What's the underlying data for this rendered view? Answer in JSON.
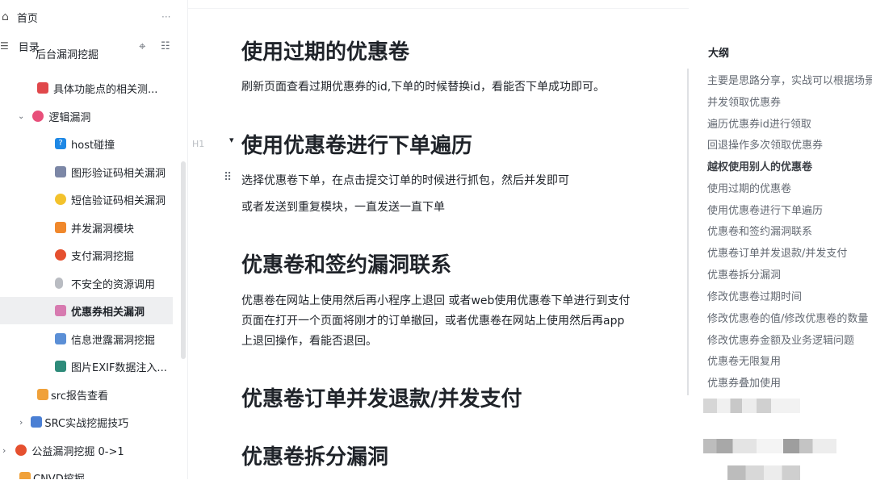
{
  "sidebar": {
    "home_label": "首页",
    "more_glyph": "···",
    "toc_label": "目录",
    "items": [
      {
        "label": "后台漏洞挖掘",
        "emoji": "",
        "color": "#ffffff"
      },
      {
        "label": "具体功能点的相关测...",
        "emoji": "ogre",
        "color": "#e0484b"
      },
      {
        "label": "逻辑漏洞",
        "emoji": "heart",
        "color": "#e84f7a",
        "expanded": true
      },
      {
        "label": "host碰撞",
        "emoji": "question",
        "color": "#1e88e5"
      },
      {
        "label": "图形验证码相关漏洞",
        "emoji": "robot",
        "color": "#7c87a6"
      },
      {
        "label": "短信验证码相关漏洞",
        "emoji": "sparkles",
        "color": "#f3c22c"
      },
      {
        "label": "并发漏洞模块",
        "emoji": "no-entry",
        "color": "#f0882c"
      },
      {
        "label": "支付漏洞挖掘",
        "emoji": "collision",
        "color": "#e5502f"
      },
      {
        "label": "不安全的资源调用",
        "emoji": "mouse",
        "color": "#b9bcc2"
      },
      {
        "label": "优惠券相关漏洞",
        "emoji": "ticket",
        "color": "#d77ab0",
        "active": true
      },
      {
        "label": "信息泄露漏洞挖掘",
        "emoji": "book",
        "color": "#5b8fd6"
      },
      {
        "label": "图片EXIF数据注入...",
        "emoji": "book-open",
        "color": "#2e8b7a"
      },
      {
        "label": "src报告查看",
        "emoji": "pizza",
        "color": "#f0a13a"
      },
      {
        "label": "SRC实战挖掘技巧",
        "emoji": "books",
        "color": "#4a7fd4"
      },
      {
        "label": "公益漏洞挖掘 0->1",
        "emoji": "collision",
        "color": "#e5502f"
      },
      {
        "label": "CNVD挖掘",
        "emoji": "pizza",
        "color": "#f0a13a"
      }
    ]
  },
  "main": {
    "h1_marker": "H1",
    "sections": [
      {
        "title": "使用过期的优惠卷",
        "paragraphs": [
          "刷新页面查看过期优惠券的id,下单的时候替换id，看能否下单成功即可。"
        ]
      },
      {
        "title": "使用优惠卷进行下单遍历",
        "paragraphs": [
          "选择优惠卷下单，在点击提交订单的时候进行抓包，然后并发即可",
          "或者发送到重复模块，一直发送一直下单"
        ]
      },
      {
        "title": "优惠卷和签约漏洞联系",
        "paragraphs": [
          "优惠卷在网站上使用然后再小程序上退回 或者web使用优惠卷下单进行到支付",
          "页面在打开一个页面将刚才的订单撤回，或者优惠卷在网站上使用然后再app",
          "上退回操作，看能否退回。"
        ]
      },
      {
        "title": "优惠卷订单并发退款/并发支付",
        "paragraphs": []
      },
      {
        "title": "优惠卷拆分漏洞",
        "paragraphs": []
      }
    ]
  },
  "outline": {
    "title": "大纲",
    "items": [
      {
        "label": "主要是思路分享，实战可以根据场景",
        "bold": false
      },
      {
        "label": "并发领取优惠券",
        "bold": false
      },
      {
        "label": "遍历优惠券id进行领取",
        "bold": false
      },
      {
        "label": "回退操作多次领取优惠券",
        "bold": false
      },
      {
        "label": "越权使用别人的优惠卷",
        "bold": true
      },
      {
        "label": "使用过期的优惠卷",
        "bold": false
      },
      {
        "label": "使用优惠卷进行下单遍历",
        "bold": false
      },
      {
        "label": "优惠卷和签约漏洞联系",
        "bold": false
      },
      {
        "label": "优惠卷订单并发退款/并发支付",
        "bold": false
      },
      {
        "label": "优惠卷拆分漏洞",
        "bold": false
      },
      {
        "label": "修改优惠卷过期时间",
        "bold": false
      },
      {
        "label": "修改优惠卷的值/修改优惠卷的数量",
        "bold": false
      },
      {
        "label": "修改优惠券金额及业务逻辑问题",
        "bold": false
      },
      {
        "label": "优惠卷无限复用",
        "bold": false
      },
      {
        "label": "优惠券叠加使用",
        "bold": false
      }
    ]
  }
}
